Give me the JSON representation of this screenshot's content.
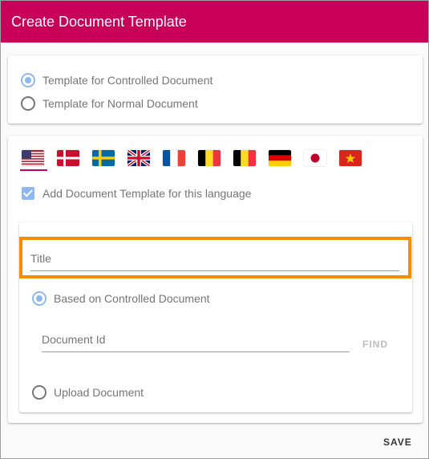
{
  "dialog": {
    "title": "Create Document Template",
    "accent_color": "#c8005a"
  },
  "template_type": {
    "options": [
      {
        "label": "Template for Controlled Document",
        "selected": true
      },
      {
        "label": "Template for Normal Document",
        "selected": false
      }
    ]
  },
  "languages": {
    "flags": [
      "us-flag",
      "denmark-flag",
      "sweden-flag",
      "uk-flag",
      "france-flag",
      "belgium-flag",
      "belgium-flag-alt",
      "germany-flag",
      "japan-flag",
      "vietnam-flag"
    ],
    "selected": "us-flag",
    "add_template_label": "Add Document Template for this language",
    "add_template_checked": true
  },
  "form": {
    "title_placeholder": "Title",
    "source_options": [
      {
        "label": "Based on Controlled Document",
        "selected": true
      },
      {
        "label": "Upload Document",
        "selected": false
      }
    ],
    "document_id_placeholder": "Document Id",
    "find_label": "FIND"
  },
  "actions": {
    "save_label": "SAVE"
  }
}
